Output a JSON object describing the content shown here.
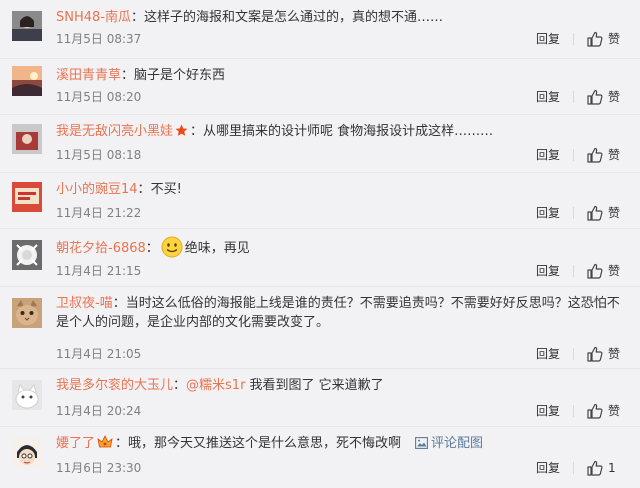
{
  "colors": {
    "background": "#f2f2f5",
    "username": "#eb7350",
    "text": "#333333",
    "meta": "#808080",
    "divider": "#e6e6e6",
    "link": "#5c7a9c"
  },
  "comments": [
    {
      "username": "SNH48-南瓜",
      "separator": "：",
      "text": "这样子的海报和文案是怎么通过的，真的想不通……",
      "time": "11月5日 08:37",
      "reply_label": "回复",
      "like_label": "赞"
    },
    {
      "username": "溪田青青草",
      "separator": "：",
      "text": "脑子是个好东西",
      "time": "11月5日 08:20",
      "reply_label": "回复",
      "like_label": "赞"
    },
    {
      "username": "我是无敌闪亮小黑娃",
      "badge_icon": "star-badge-icon",
      "separator": "：",
      "text": "从哪里搞来的设计师呢 食物海报设计成这样………",
      "time": "11月5日 08:18",
      "reply_label": "回复",
      "like_label": "赞"
    },
    {
      "username": "小小的豌豆14",
      "separator": "：",
      "text": "不买!",
      "time": "11月4日 21:22",
      "reply_label": "回复",
      "like_label": "赞"
    },
    {
      "username": "朝花夕拾-6868",
      "separator": "：",
      "emoji_icon": "smile-emoji-icon",
      "text": "绝味，再见",
      "time": "11月4日 21:15",
      "reply_label": "回复",
      "like_label": "赞"
    },
    {
      "username": "卫叔夜-喵",
      "separator": "：",
      "text": "当时这么低俗的海报能上线是谁的责任？不需要追责吗？不需要好好反思吗？这恐怕不是个人的问题，是企业内部的文化需要改变了。",
      "time": "11月4日 21:05",
      "reply_label": "回复",
      "like_label": "赞"
    },
    {
      "username": "我是多尔衮的大玉儿",
      "separator": "：",
      "mention": "@糯米s1r",
      "text": " 我看到图了 它来道歉了",
      "time": "11月4日 20:24",
      "reply_label": "回复",
      "like_label": "赞"
    },
    {
      "username": "婹了了",
      "badge_icon": "crown-badge-icon",
      "separator": "：",
      "text": "哦，那今天又推送这个是什么意思，死不悔改啊",
      "pic_link": "评论配图",
      "pic_icon": "image-icon",
      "time": "11月6日 23:30",
      "reply_label": "回复",
      "like_count": "1"
    }
  ]
}
